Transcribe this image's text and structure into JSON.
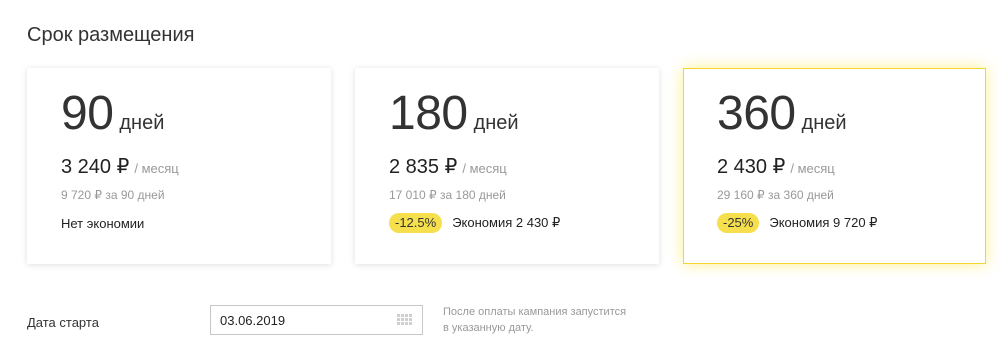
{
  "section": {
    "title": "Срок размещения"
  },
  "plans": [
    {
      "days": "90",
      "days_unit": "дней",
      "price": "3 240 ₽",
      "per": "/ месяц",
      "total": "9 720 ₽ за 90 дней",
      "no_saving": "Нет экономии"
    },
    {
      "days": "180",
      "days_unit": "дней",
      "price": "2 835 ₽",
      "per": "/ месяц",
      "total": "17 010 ₽ за 180 дней",
      "discount": "-12.5%",
      "saving": "Экономия 2 430 ₽"
    },
    {
      "days": "360",
      "days_unit": "дней",
      "price": "2 430 ₽",
      "per": "/ месяц",
      "total": "29 160 ₽ за 360 дней",
      "discount": "-25%",
      "saving": "Экономия 9 720 ₽",
      "selected": true
    }
  ],
  "start": {
    "label": "Дата старта",
    "date_value": "03.06.2019",
    "hint_line1": "После оплаты кампания запустится",
    "hint_line2": "в указанную дату."
  },
  "colors": {
    "accent": "#f5df4d",
    "selected_border": "#f2d52e",
    "muted": "#999999"
  },
  "icons": {
    "calendar": "calendar-icon"
  }
}
